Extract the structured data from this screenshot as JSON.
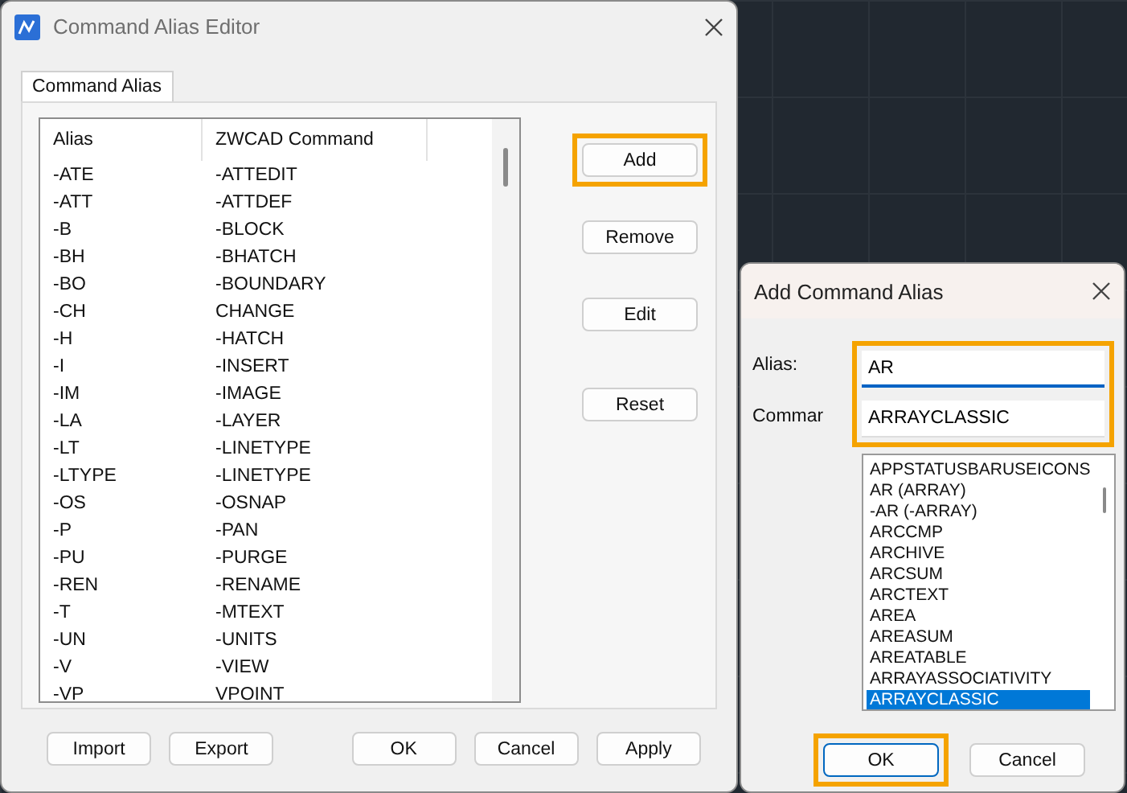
{
  "editor": {
    "title": "Command Alias Editor",
    "tabs": [
      {
        "label": "Command Alias",
        "selected": true
      }
    ],
    "table": {
      "columns": [
        "Alias",
        "ZWCAD Command"
      ],
      "rows": [
        {
          "alias": "-ATE",
          "command": "-ATTEDIT"
        },
        {
          "alias": "-ATT",
          "command": "-ATTDEF"
        },
        {
          "alias": "-B",
          "command": "-BLOCK"
        },
        {
          "alias": "-BH",
          "command": "-BHATCH"
        },
        {
          "alias": "-BO",
          "command": "-BOUNDARY"
        },
        {
          "alias": "-CH",
          "command": "CHANGE"
        },
        {
          "alias": "-H",
          "command": "-HATCH"
        },
        {
          "alias": "-I",
          "command": "-INSERT"
        },
        {
          "alias": "-IM",
          "command": "-IMAGE"
        },
        {
          "alias": "-LA",
          "command": "-LAYER"
        },
        {
          "alias": "-LT",
          "command": "-LINETYPE"
        },
        {
          "alias": "-LTYPE",
          "command": "-LINETYPE"
        },
        {
          "alias": "-OS",
          "command": "-OSNAP"
        },
        {
          "alias": "-P",
          "command": "-PAN"
        },
        {
          "alias": "-PU",
          "command": "-PURGE"
        },
        {
          "alias": "-REN",
          "command": "-RENAME"
        },
        {
          "alias": "-T",
          "command": "-MTEXT"
        },
        {
          "alias": "-UN",
          "command": "-UNITS"
        },
        {
          "alias": "-V",
          "command": "-VIEW"
        },
        {
          "alias": "-VP",
          "command": "VPOINT"
        }
      ]
    },
    "side_buttons": [
      {
        "label": "Add",
        "highlighted": true
      },
      {
        "label": "Remove",
        "highlighted": false
      },
      {
        "label": "Edit",
        "highlighted": false
      },
      {
        "label": "Reset",
        "highlighted": false
      }
    ],
    "bottom_buttons": [
      {
        "label": "Import"
      },
      {
        "label": "Export"
      },
      {
        "label": "OK"
      },
      {
        "label": "Cancel"
      },
      {
        "label": "Apply"
      }
    ]
  },
  "add_dialog": {
    "title": "Add Command Alias",
    "fields_highlighted": true,
    "fields": [
      {
        "label": "Alias:",
        "value": "AR",
        "focused": true
      },
      {
        "label": "Commar",
        "value": "ARRAYCLASSIC",
        "focused": false
      }
    ],
    "list": [
      {
        "text": "APPSTATUSBARUSEICONS",
        "selected": false
      },
      {
        "text": "AR (ARRAY)",
        "selected": false
      },
      {
        "text": "-AR (-ARRAY)",
        "selected": false
      },
      {
        "text": "ARCCMP",
        "selected": false
      },
      {
        "text": "ARCHIVE",
        "selected": false
      },
      {
        "text": "ARCSUM",
        "selected": false
      },
      {
        "text": "ARCTEXT",
        "selected": false
      },
      {
        "text": "AREA",
        "selected": false
      },
      {
        "text": "AREASUM",
        "selected": false
      },
      {
        "text": "AREATABLE",
        "selected": false
      },
      {
        "text": "ARRAYASSOCIATIVITY",
        "selected": false
      },
      {
        "text": "ARRAYCLASSIC",
        "selected": true
      }
    ],
    "buttons": [
      {
        "label": "OK",
        "highlighted": true,
        "default": true
      },
      {
        "label": "Cancel",
        "highlighted": false,
        "default": false
      }
    ]
  }
}
